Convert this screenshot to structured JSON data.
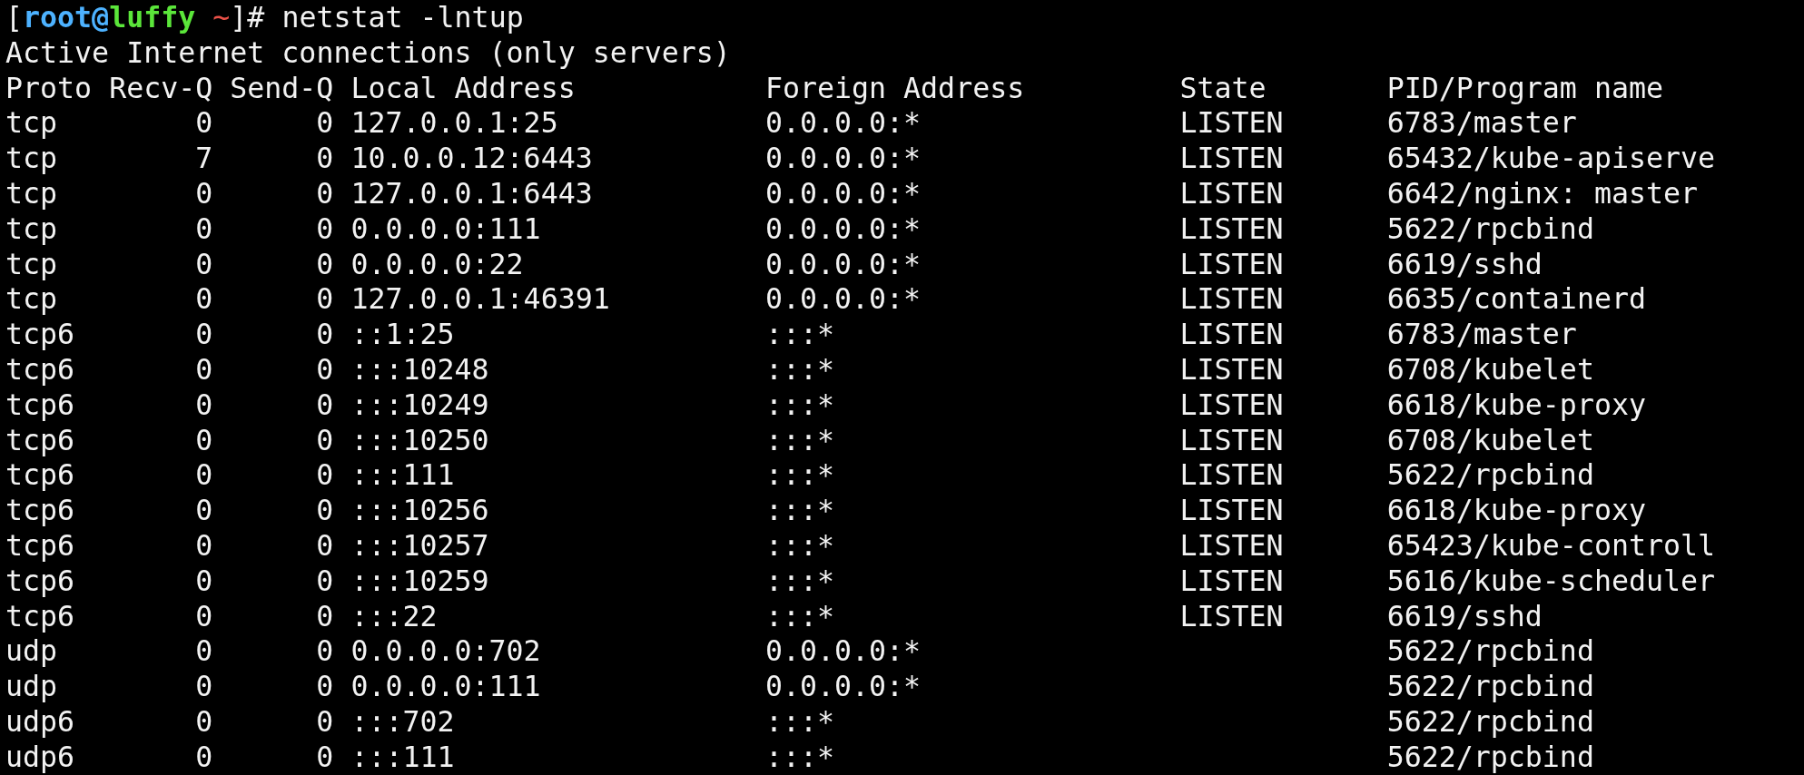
{
  "prompt": {
    "segments": [
      {
        "kind": "plain",
        "text": "["
      },
      {
        "kind": "user",
        "text": "root@"
      },
      {
        "kind": "host",
        "text": "luffy"
      },
      {
        "kind": "path",
        "text": " ~"
      },
      {
        "kind": "plain",
        "text": "]#"
      }
    ],
    "command": "netstat -lntup"
  },
  "title": "Active Internet connections (only servers)",
  "table": {
    "columns": [
      "Proto",
      "Recv-Q",
      "Send-Q",
      "Local Address",
      "Foreign Address",
      "State",
      "PID/Program name"
    ],
    "rows": [
      [
        "tcp",
        "0",
        "0",
        "127.0.0.1:25",
        "0.0.0.0:*",
        "LISTEN",
        "6783/master"
      ],
      [
        "tcp",
        "7",
        "0",
        "10.0.0.12:6443",
        "0.0.0.0:*",
        "LISTEN",
        "65432/kube-apiserve"
      ],
      [
        "tcp",
        "0",
        "0",
        "127.0.0.1:6443",
        "0.0.0.0:*",
        "LISTEN",
        "6642/nginx: master"
      ],
      [
        "tcp",
        "0",
        "0",
        "0.0.0.0:111",
        "0.0.0.0:*",
        "LISTEN",
        "5622/rpcbind"
      ],
      [
        "tcp",
        "0",
        "0",
        "0.0.0.0:22",
        "0.0.0.0:*",
        "LISTEN",
        "6619/sshd"
      ],
      [
        "tcp",
        "0",
        "0",
        "127.0.0.1:46391",
        "0.0.0.0:*",
        "LISTEN",
        "6635/containerd"
      ],
      [
        "tcp6",
        "0",
        "0",
        "::1:25",
        ":::*",
        "LISTEN",
        "6783/master"
      ],
      [
        "tcp6",
        "0",
        "0",
        ":::10248",
        ":::*",
        "LISTEN",
        "6708/kubelet"
      ],
      [
        "tcp6",
        "0",
        "0",
        ":::10249",
        ":::*",
        "LISTEN",
        "6618/kube-proxy"
      ],
      [
        "tcp6",
        "0",
        "0",
        ":::10250",
        ":::*",
        "LISTEN",
        "6708/kubelet"
      ],
      [
        "tcp6",
        "0",
        "0",
        ":::111",
        ":::*",
        "LISTEN",
        "5622/rpcbind"
      ],
      [
        "tcp6",
        "0",
        "0",
        ":::10256",
        ":::*",
        "LISTEN",
        "6618/kube-proxy"
      ],
      [
        "tcp6",
        "0",
        "0",
        ":::10257",
        ":::*",
        "LISTEN",
        "65423/kube-controll"
      ],
      [
        "tcp6",
        "0",
        "0",
        ":::10259",
        ":::*",
        "LISTEN",
        "5616/kube-scheduler"
      ],
      [
        "tcp6",
        "0",
        "0",
        ":::22",
        ":::*",
        "LISTEN",
        "6619/sshd"
      ],
      [
        "udp",
        "0",
        "0",
        "0.0.0.0:702",
        "0.0.0.0:*",
        null,
        "5622/rpcbind"
      ],
      [
        "udp",
        "0",
        "0",
        "0.0.0.0:111",
        "0.0.0.0:*",
        null,
        "5622/rpcbind"
      ],
      [
        "udp6",
        "0",
        "0",
        ":::702",
        ":::*",
        null,
        "5622/rpcbind"
      ],
      [
        "udp6",
        "0",
        "0",
        ":::111",
        ":::*",
        null,
        "5622/rpcbind"
      ]
    ]
  }
}
